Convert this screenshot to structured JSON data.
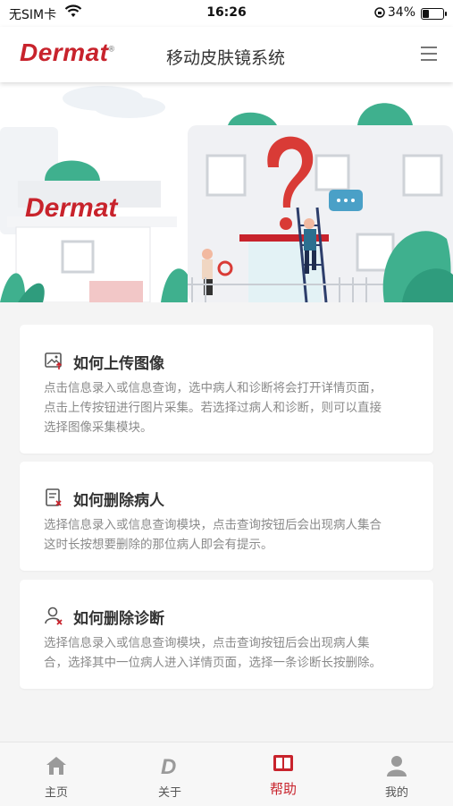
{
  "status_bar": {
    "carrier": "无SIM卡",
    "time": "16:26",
    "battery_percent": "34%",
    "battery_level": 0.34
  },
  "header": {
    "logo": "Dermat",
    "title": "移动皮肤镜系统"
  },
  "banner": {
    "building_logo": "Dermat"
  },
  "help_items": [
    {
      "icon": "image-upload-icon",
      "title": "如何上传图像",
      "lines": [
        "点击信息录入或信息查询，选中病人和诊断将会打开详情页面，",
        "点击上传按钮进行图片采集。若选择过病人和诊断，则可以直接",
        "选择图像采集模块。"
      ]
    },
    {
      "icon": "delete-document-icon",
      "title": "如何删除病人",
      "lines": [
        "选择信息录入或信息查询模块，点击查询按钮后会出现病人集合",
        "这时长按想要删除的那位病人即会有提示。"
      ]
    },
    {
      "icon": "user-delete-icon",
      "title": "如何删除诊断",
      "lines": [
        "选择信息录入或信息查询模块，点击查询按钮后会出现病人集",
        "合，选择其中一位病人进入详情页面，选择一条诊断长按删除。"
      ]
    }
  ],
  "tab_bar": {
    "items": [
      {
        "label": "主页",
        "icon": "home-icon"
      },
      {
        "label": "关于",
        "icon": "d-logo-icon"
      },
      {
        "label": "帮助",
        "icon": "book-icon"
      },
      {
        "label": "我的",
        "icon": "person-icon"
      }
    ],
    "active_index": 2
  },
  "colors": {
    "brand": "#c8232c",
    "green": "#3fb08e",
    "text_secondary": "#8a8a8a"
  }
}
